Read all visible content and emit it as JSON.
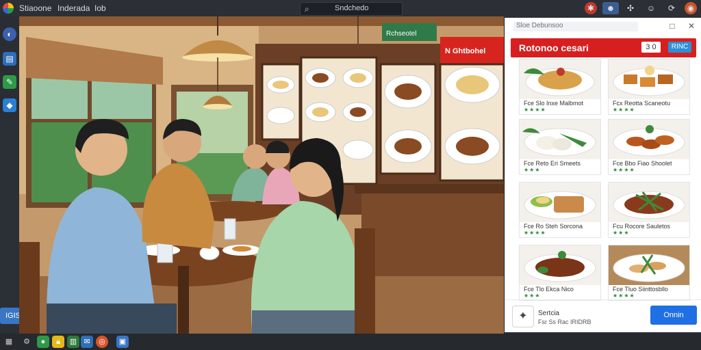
{
  "topbar": {
    "app_title": "Stiaoone",
    "menu": [
      "Inderada",
      "Iob"
    ],
    "search_text": "Sndchedo",
    "icons": [
      "bug-icon",
      "profile-icon",
      "puzzle-icon",
      "help-icon",
      "sync-icon",
      "account-icon"
    ]
  },
  "leftdock": {
    "badge_label": "IGIS"
  },
  "panel": {
    "title": "Sloe Debunsoo",
    "header_title": "Rotonoo cesari",
    "qty": "3 0",
    "header_button": "RINC",
    "items": [
      {
        "name": "Fce Slo Inxe Malbmot",
        "stars": "★★★★"
      },
      {
        "name": "Fcx Reotta Scaneotu",
        "stars": "★★★★"
      },
      {
        "name": "Fce Reto Eri Smeets",
        "stars": "★★★"
      },
      {
        "name": "Fce Bbo Fiao Shoolet",
        "stars": "★★★★"
      },
      {
        "name": "Fce Ro Steh Sorcona",
        "stars": "★★★★"
      },
      {
        "name": "Fcu Rocore Sauletos",
        "stars": "★★★"
      },
      {
        "name": "Fce Tlo Ekca Nico",
        "stars": "★★★"
      },
      {
        "name": "Fce Tluo Siinttosbllo",
        "stars": "★★★★"
      }
    ],
    "footer_title": "Sertcia",
    "footer_sub": "Fsr Ss Rac IRIDRB",
    "footer_button": "Onnin"
  },
  "scene": {
    "wall_sign": "Rchseotel",
    "menu_board_title": "N Ghtbohel"
  }
}
